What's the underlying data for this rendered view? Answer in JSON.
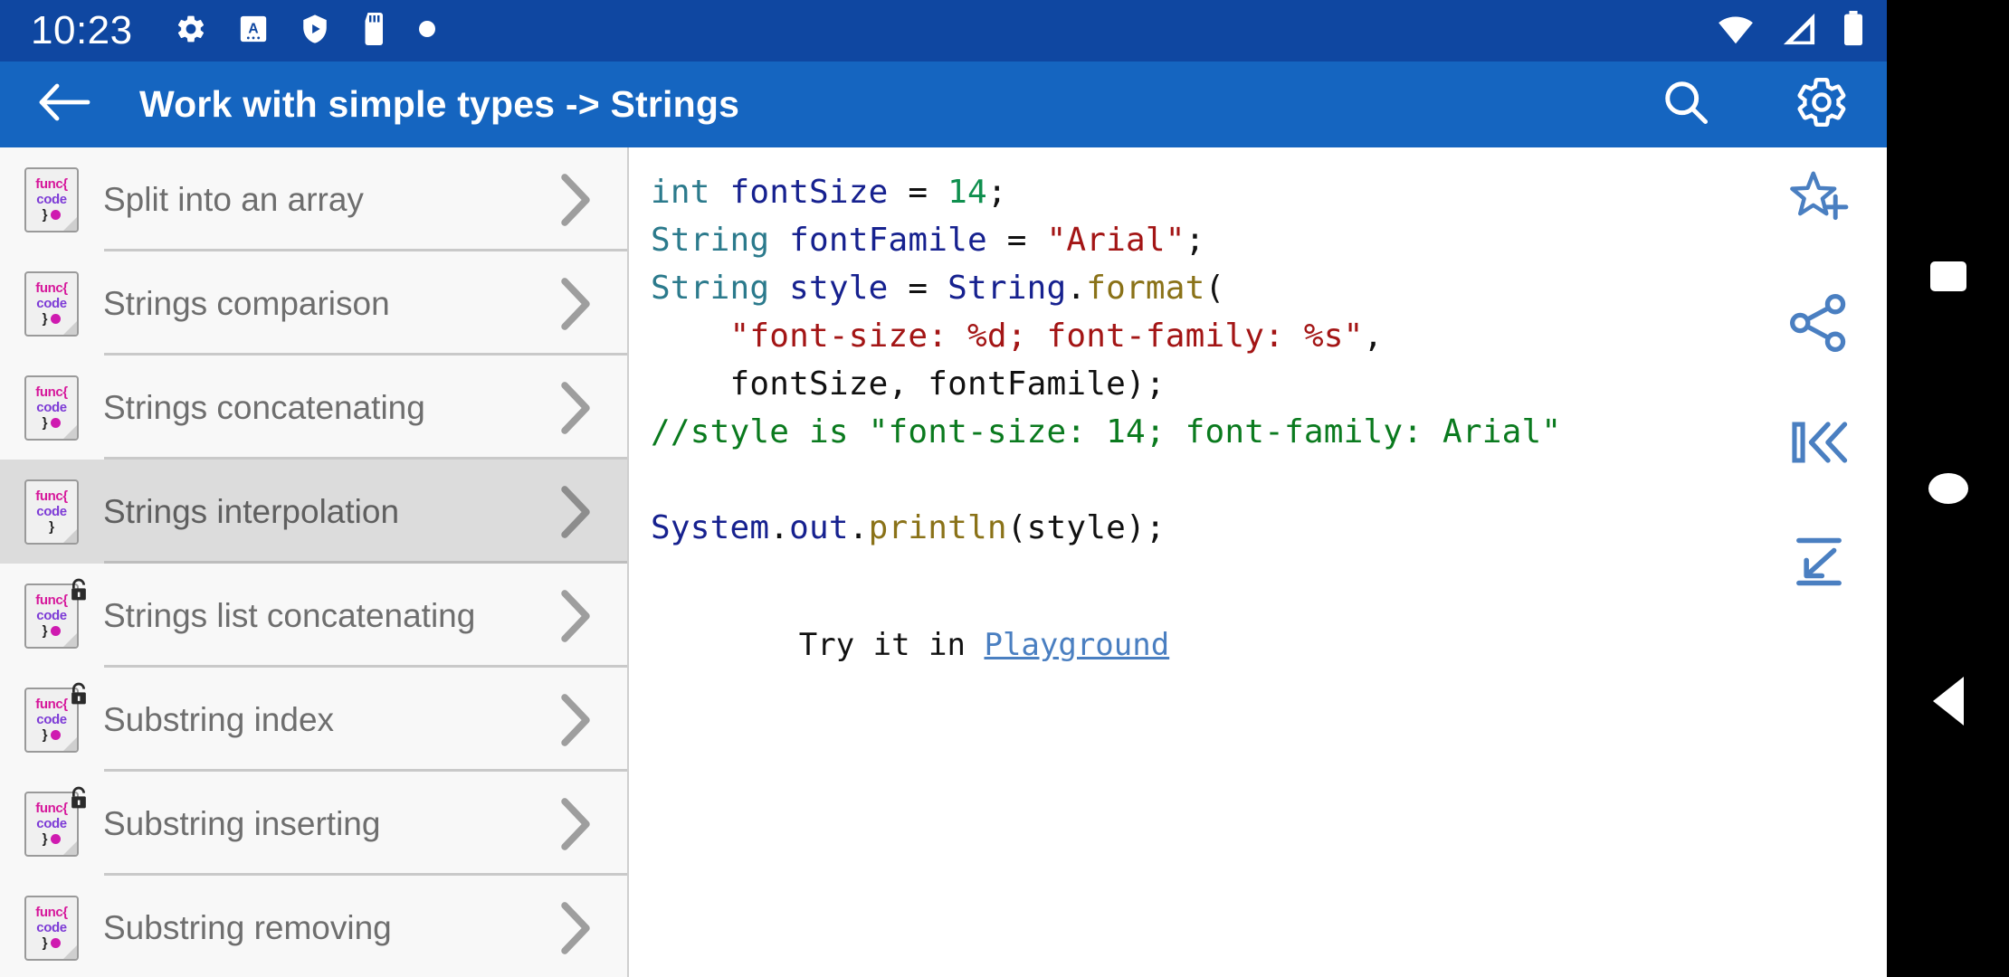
{
  "status_bar": {
    "time": "10:23",
    "left_icons": [
      "gear-icon",
      "app-letter-a-icon",
      "shield-play-icon",
      "sd-card-icon",
      "dot-icon"
    ],
    "right_icons": [
      "wifi-icon",
      "cellular-signal-icon",
      "battery-icon"
    ],
    "background_color": "#0f47a1"
  },
  "app_bar": {
    "back_label": "back-arrow",
    "title": "Work with simple types -> Strings",
    "search_label": "search",
    "settings_label": "settings",
    "background_color": "#1565c0"
  },
  "sidebar": {
    "background_color": "#f8f8f8",
    "selected_color": "#dcdcdc",
    "icon_text": {
      "line1": "func{",
      "line2": "code",
      "line3": "}"
    },
    "items": [
      {
        "label": "Split into an array",
        "locked": false,
        "selected": false,
        "has_dot": true
      },
      {
        "label": "Strings comparison",
        "locked": false,
        "selected": false,
        "has_dot": true
      },
      {
        "label": "Strings concatenating",
        "locked": false,
        "selected": false,
        "has_dot": true
      },
      {
        "label": "Strings interpolation",
        "locked": false,
        "selected": true,
        "has_dot": false
      },
      {
        "label": "Strings list concatenating",
        "locked": true,
        "selected": false,
        "has_dot": true
      },
      {
        "label": "Substring index",
        "locked": true,
        "selected": false,
        "has_dot": true
      },
      {
        "label": "Substring inserting",
        "locked": true,
        "selected": false,
        "has_dot": true
      },
      {
        "label": "Substring removing",
        "locked": false,
        "selected": false,
        "has_dot": true
      }
    ]
  },
  "code_pane": {
    "lines": [
      [
        {
          "t": "int",
          "c": "type"
        },
        {
          "t": " ",
          "c": "plain"
        },
        {
          "t": "fontSize",
          "c": "ident"
        },
        {
          "t": " = ",
          "c": "plain"
        },
        {
          "t": "14",
          "c": "num"
        },
        {
          "t": ";",
          "c": "punc"
        }
      ],
      [
        {
          "t": "String",
          "c": "type"
        },
        {
          "t": " ",
          "c": "plain"
        },
        {
          "t": "fontFamile",
          "c": "ident"
        },
        {
          "t": " = ",
          "c": "plain"
        },
        {
          "t": "\"Arial\"",
          "c": "str"
        },
        {
          "t": ";",
          "c": "punc"
        }
      ],
      [
        {
          "t": "String",
          "c": "type"
        },
        {
          "t": " ",
          "c": "plain"
        },
        {
          "t": "style",
          "c": "ident"
        },
        {
          "t": " = ",
          "c": "plain"
        },
        {
          "t": "String",
          "c": "ident"
        },
        {
          "t": ".",
          "c": "punc"
        },
        {
          "t": "format",
          "c": "method"
        },
        {
          "t": "(",
          "c": "punc"
        }
      ],
      [
        {
          "t": "    ",
          "c": "plain"
        },
        {
          "t": "\"font-size: %d; font-family: %s\"",
          "c": "str"
        },
        {
          "t": ",",
          "c": "punc"
        }
      ],
      [
        {
          "t": "   ",
          "c": "plain"
        },
        {
          "t": " fontSize, fontFamile);",
          "c": "plain"
        }
      ],
      [
        {
          "t": "//style is \"font-size: 14; font-family: Arial\"",
          "c": "comment"
        }
      ],
      [
        {
          "t": "",
          "c": "plain"
        }
      ],
      [
        {
          "t": "System",
          "c": "ident"
        },
        {
          "t": ".",
          "c": "punc"
        },
        {
          "t": "out",
          "c": "ident"
        },
        {
          "t": ".",
          "c": "punc"
        },
        {
          "t": "println",
          "c": "method"
        },
        {
          "t": "(style);",
          "c": "plain"
        }
      ]
    ],
    "try_prefix": "Try it in ",
    "try_link": "Playground",
    "link_color": "#4a7fc1"
  },
  "action_rail": {
    "buttons": [
      {
        "name": "add-to-favorites",
        "icon": "star-plus-icon"
      },
      {
        "name": "share",
        "icon": "share-icon"
      },
      {
        "name": "collapse-panel",
        "icon": "collapse-left-icon"
      },
      {
        "name": "fit-content",
        "icon": "arrow-down-between-lines-icon"
      }
    ],
    "color": "#4a7fc1"
  },
  "nav_bar": {
    "buttons": [
      {
        "name": "recents",
        "icon": "square-icon"
      },
      {
        "name": "home",
        "icon": "circle-icon"
      },
      {
        "name": "back",
        "icon": "triangle-left-icon"
      }
    ],
    "background_color": "#000000"
  }
}
